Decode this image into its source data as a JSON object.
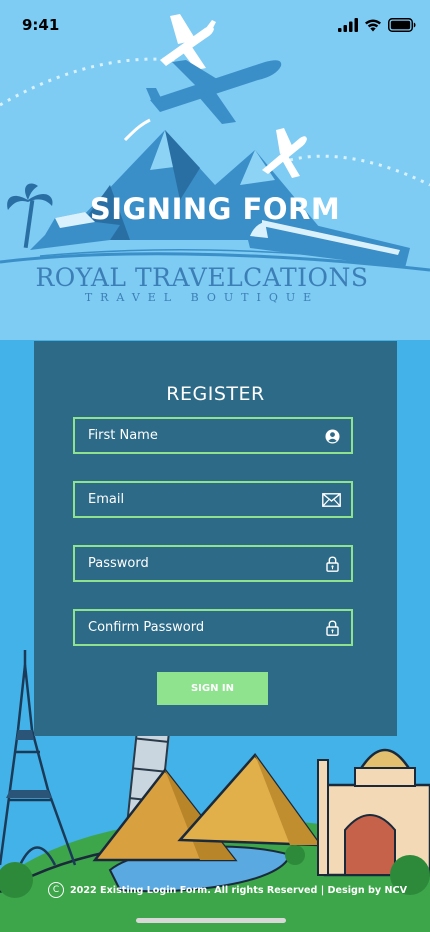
{
  "status_bar": {
    "time": "9:41",
    "icons": [
      "signal-icon",
      "wifi-icon",
      "battery-icon"
    ]
  },
  "hero": {
    "title": "SIGNING FORM",
    "brand_name": "ROYAL TRAVELCATIONS",
    "brand_tagline": "TRAVEL BOUTIQUE"
  },
  "form": {
    "title": "REGISTER",
    "fields": [
      {
        "placeholder": "First Name",
        "value": "",
        "icon": "user-icon"
      },
      {
        "placeholder": "Email",
        "value": "",
        "icon": "envelope-icon"
      },
      {
        "placeholder": "Password",
        "value": "",
        "icon": "lock-icon"
      },
      {
        "placeholder": "Confirm Password",
        "value": "",
        "icon": "lock-icon"
      }
    ],
    "submit_label": "SIGN IN"
  },
  "footer": {
    "copyright_symbol": "C",
    "text": "2022 Existing Login Form. All rights Reserved | Design by NCV"
  },
  "colors": {
    "header_bg": "#7ecbf3",
    "page_bg": "#42b2e8",
    "card_bg": "#2c6a87",
    "accent_green": "#8fe38f",
    "brand_blue": "#3c7fb6"
  }
}
